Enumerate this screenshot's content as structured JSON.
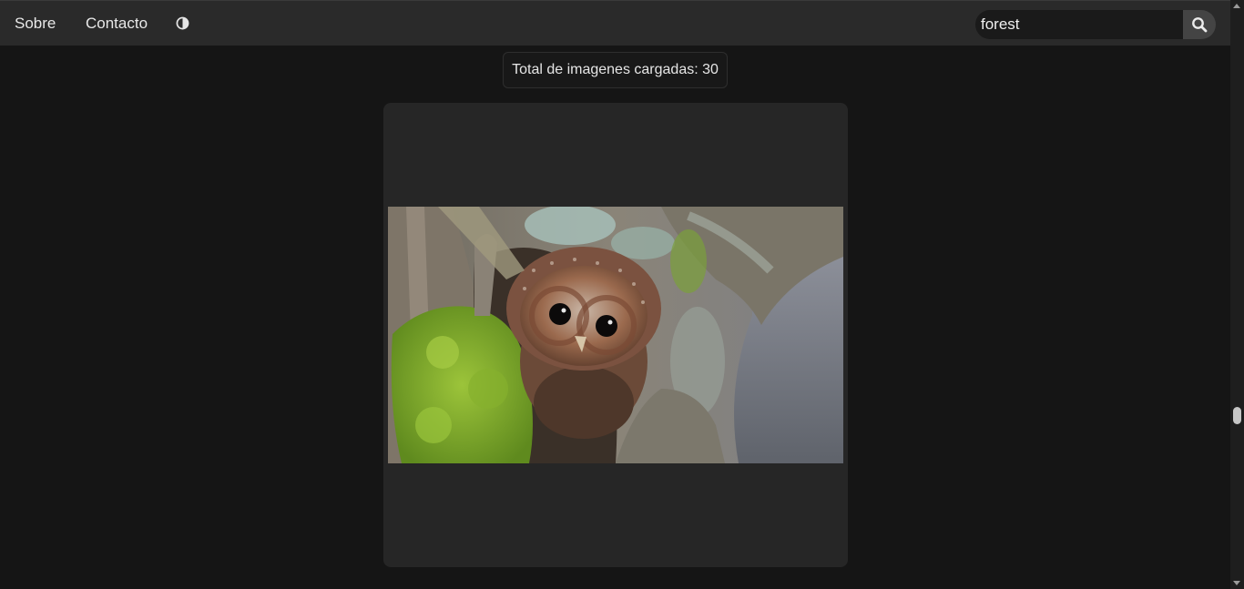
{
  "nav": {
    "links": [
      {
        "label": "Sobre"
      },
      {
        "label": "Contacto"
      }
    ],
    "theme_icon": "contrast-icon"
  },
  "search": {
    "value": "forest",
    "button_icon": "search-icon"
  },
  "counter": {
    "text": "Total de imagenes cargadas: 30"
  },
  "card": {
    "image_subject": "owl-in-tree-hollow"
  },
  "colors": {
    "background": "#151515",
    "navbar": "#2a2a2a",
    "card": "#262626",
    "search_button": "#444444"
  }
}
